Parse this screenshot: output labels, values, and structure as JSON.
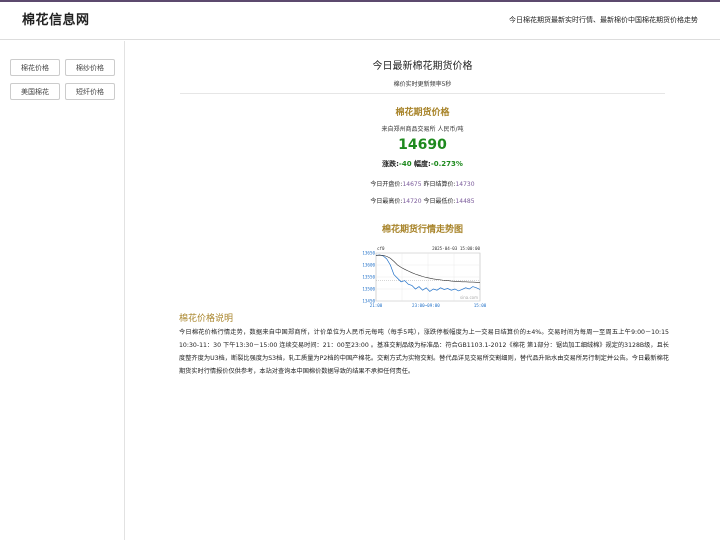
{
  "header": {
    "logo": "棉花信息网",
    "tagline": "今日棉花期货最新实时行情、最新棉价中国棉花期货价格走势"
  },
  "sidebar": {
    "items": [
      {
        "label": "棉花价格"
      },
      {
        "label": "棉纱价格"
      },
      {
        "label": "美国棉花"
      },
      {
        "label": "短纤价格"
      }
    ]
  },
  "main": {
    "title": "今日最新棉花期货价格",
    "update_note": "棉价实时更新频率5秒",
    "futures": {
      "heading": "棉花期货价格",
      "source": "来自郑州商品交易所 人民币/吨",
      "price": "14690",
      "change_label": "涨跌:",
      "change_value": "-40",
      "pct_label": "幅度:",
      "pct_value": "-0.273%",
      "open_label": "今日开盘价:",
      "open_value": "14675",
      "settle_label": "昨日结算价:",
      "settle_value": "14730",
      "high_label": "今日最高价:",
      "high_value": "14720",
      "low_label": "今日最低价:",
      "low_value": "14485"
    },
    "trend": {
      "heading": "棉花期货行情走势图"
    },
    "explain": {
      "heading": "棉花价格说明",
      "text": "今日棉花价格行情走势，数据来自中国郑商所，计价单位为人民币元每吨（每手5吨），涨跌停板幅度为上一交易日结算价的±4%。交易时间为每周一至周五上午9:00－10:15 10:30-11：30 下午13:30－15:00 连续交易时间：21：00至23:00 。基准交割品级为标准品：符合GB1103.1-2012《棉花 第1部分：锯齿加工细绒棉》规定的3128B级，且长度整齐度为U3档，断裂比强度为S3档，轧工质量为P2档的中国产棉花。交割方式为实物交割。替代品详见交易所交割细则，替代品升贴水由交易所另行制定并公告。今日最新棉花期货实时行情报价仅供参考，本站对查询本中国棉价数据导致的结果不承担任何责任。"
    }
  },
  "chart_data": {
    "type": "line",
    "title": "",
    "code": "cf0",
    "datetime": "2025-04-03 15:00:00",
    "watermark": "sina.com",
    "ylim": [
      13450,
      13650
    ],
    "yticks": [
      13650,
      13600,
      13550,
      13500,
      13450
    ],
    "xticks": [
      "21:00",
      "23:00~09:00",
      "15:00"
    ],
    "series": [
      {
        "color": "#1e6fc8",
        "values": [
          13640,
          13642,
          13638,
          13625,
          13600,
          13560,
          13545,
          13530,
          13535,
          13520,
          13515,
          13500,
          13510,
          13495,
          13505,
          13490,
          13500,
          13495,
          13505,
          13498,
          13502,
          13495,
          13500,
          13492,
          13498,
          13505,
          13500,
          13510,
          13505,
          13498
        ]
      },
      {
        "color": "#333333",
        "values": [
          13640,
          13641,
          13640,
          13636,
          13628,
          13615,
          13600,
          13590,
          13582,
          13575,
          13568,
          13562,
          13557,
          13552,
          13548,
          13545,
          13542,
          13540,
          13538,
          13536,
          13535,
          13533,
          13532,
          13531,
          13530,
          13530,
          13529,
          13529,
          13528,
          13528
        ]
      }
    ],
    "reference_line": 13535,
    "grid": true
  }
}
